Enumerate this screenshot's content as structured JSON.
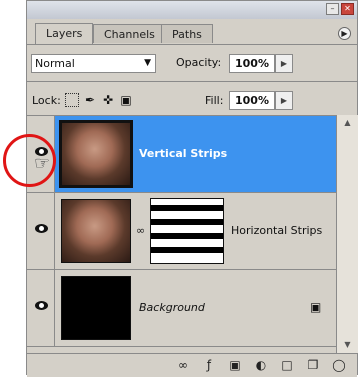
{
  "tabs": [
    "Layers",
    "Channels",
    "Paths"
  ],
  "blend_mode": "Normal",
  "opacity": {
    "label": "Opacity:",
    "value": "100%"
  },
  "lock": {
    "label": "Lock:"
  },
  "fill": {
    "label": "Fill:",
    "value": "100%"
  },
  "layers": [
    {
      "name": "Vertical Strips",
      "selected": true,
      "visible": true
    },
    {
      "name": "Horizontal Strips",
      "selected": false,
      "visible": true
    },
    {
      "name": "Background",
      "selected": false,
      "visible": true,
      "locked": true
    }
  ],
  "colors": {
    "selection": "#3d93ef",
    "panel": "#d4d0c8",
    "highlight_circle": "#e01515"
  },
  "bottom_icons": [
    "link-layers-icon",
    "layer-style-icon",
    "add-mask-icon",
    "adjustment-layer-icon",
    "new-group-icon",
    "new-layer-icon",
    "delete-layer-icon"
  ]
}
